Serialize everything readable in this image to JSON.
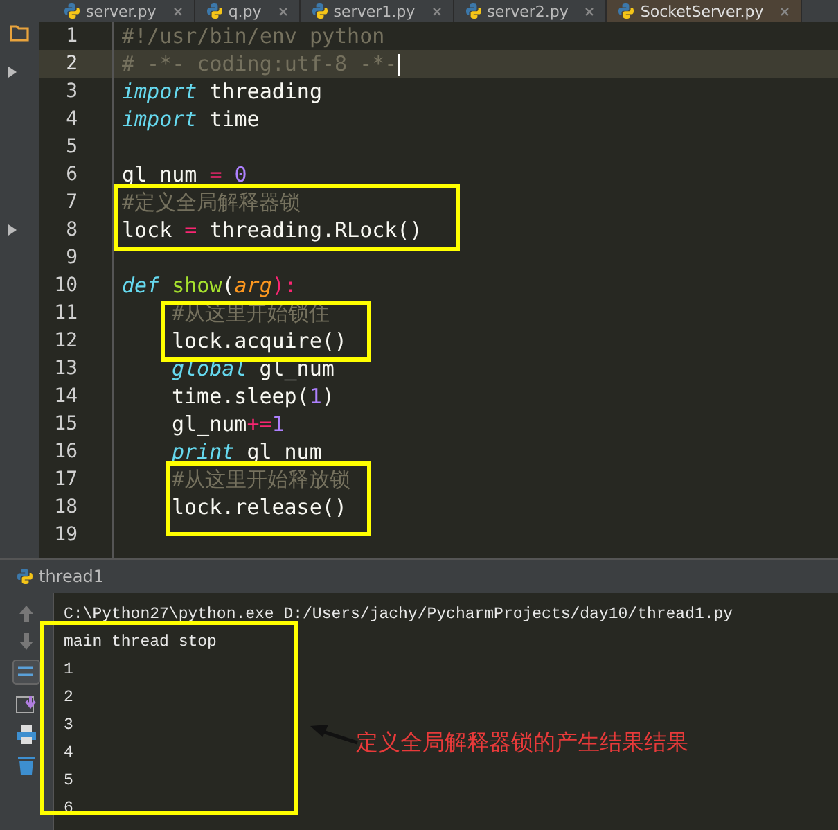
{
  "tabs": [
    {
      "label": "server.py",
      "selected": false
    },
    {
      "label": "q.py",
      "selected": false
    },
    {
      "label": "server1.py",
      "selected": false
    },
    {
      "label": "server2.py",
      "selected": false
    },
    {
      "label": "SocketServer.py",
      "selected": true
    }
  ],
  "editor": {
    "lines": [
      {
        "number": "1",
        "current": false,
        "indent": false,
        "tokens": [
          {
            "text": "#!/usr/bin/env python",
            "kind": "comment"
          }
        ]
      },
      {
        "number": "2",
        "current": true,
        "indent": false,
        "tokens": [
          {
            "text": "# -*- coding:utf-8 -*-",
            "kind": "comment"
          }
        ]
      },
      {
        "number": "3",
        "current": false,
        "indent": false,
        "tokens": [
          {
            "text": "import ",
            "kind": "keyword"
          },
          {
            "text": "threading",
            "kind": "plain"
          }
        ]
      },
      {
        "number": "4",
        "current": false,
        "indent": false,
        "tokens": [
          {
            "text": "import ",
            "kind": "keyword"
          },
          {
            "text": "time",
            "kind": "plain"
          }
        ]
      },
      {
        "number": "5",
        "current": false
      },
      {
        "number": "6",
        "current": false,
        "indent": false,
        "tokens": [
          {
            "text": "gl_num ",
            "kind": "plain"
          },
          {
            "text": "= ",
            "kind": "op"
          },
          {
            "text": "0",
            "kind": "number"
          }
        ]
      },
      {
        "number": "7",
        "current": false,
        "indent": false,
        "tokens": [
          {
            "text": "#定义全局解释器锁",
            "kind": "comment"
          }
        ]
      },
      {
        "number": "8",
        "current": false,
        "indent": false,
        "tokens": [
          {
            "text": "lock ",
            "kind": "plain"
          },
          {
            "text": "= ",
            "kind": "op"
          },
          {
            "text": "threading.RLock()",
            "kind": "plain"
          }
        ]
      },
      {
        "number": "9",
        "current": false
      },
      {
        "number": "10",
        "current": false,
        "indent": false,
        "tokens": [
          {
            "text": "def ",
            "kind": "keyword"
          },
          {
            "text": "show",
            "kind": "func"
          },
          {
            "text": "(",
            "kind": "plain"
          },
          {
            "text": "arg",
            "kind": "param"
          },
          {
            "text": "):",
            "kind": "op"
          }
        ]
      },
      {
        "number": "11",
        "current": false,
        "indent": true,
        "tokens": [
          {
            "text": "#从这里开始锁住",
            "kind": "comment"
          }
        ]
      },
      {
        "number": "12",
        "current": false,
        "indent": true,
        "tokens": [
          {
            "text": "lock.acquire()",
            "kind": "plain"
          }
        ]
      },
      {
        "number": "13",
        "current": false,
        "indent": true,
        "tokens": [
          {
            "text": "global ",
            "kind": "keyword"
          },
          {
            "text": "gl_num",
            "kind": "plain"
          }
        ]
      },
      {
        "number": "14",
        "current": false,
        "indent": true,
        "tokens": [
          {
            "text": "time.sleep(",
            "kind": "plain"
          },
          {
            "text": "1",
            "kind": "number"
          },
          {
            "text": ")",
            "kind": "plain"
          }
        ]
      },
      {
        "number": "15",
        "current": false,
        "indent": true,
        "tokens": [
          {
            "text": "gl_num",
            "kind": "plain"
          },
          {
            "text": "+=",
            "kind": "op"
          },
          {
            "text": "1",
            "kind": "number"
          }
        ]
      },
      {
        "number": "16",
        "current": false,
        "indent": true,
        "tokens": [
          {
            "text": "print ",
            "kind": "keyword"
          },
          {
            "text": "gl_num",
            "kind": "plain"
          }
        ]
      },
      {
        "number": "17",
        "current": false,
        "indent": true,
        "tokens": [
          {
            "text": "#从这里开始释放锁",
            "kind": "comment"
          }
        ]
      },
      {
        "number": "18",
        "current": false,
        "indent": true,
        "tokens": [
          {
            "text": "lock.release()",
            "kind": "plain"
          }
        ]
      },
      {
        "number": "19",
        "current": false
      }
    ]
  },
  "run_panel": {
    "title": "thread1",
    "console": [
      "C:\\Python27\\python.exe D:/Users/jachy/PycharmProjects/day10/thread1.py",
      "main thread stop",
      "1",
      "2",
      "3",
      "4",
      "5",
      "6"
    ]
  },
  "annotation": {
    "text": "定义全局解释器锁的产生结果结果"
  }
}
